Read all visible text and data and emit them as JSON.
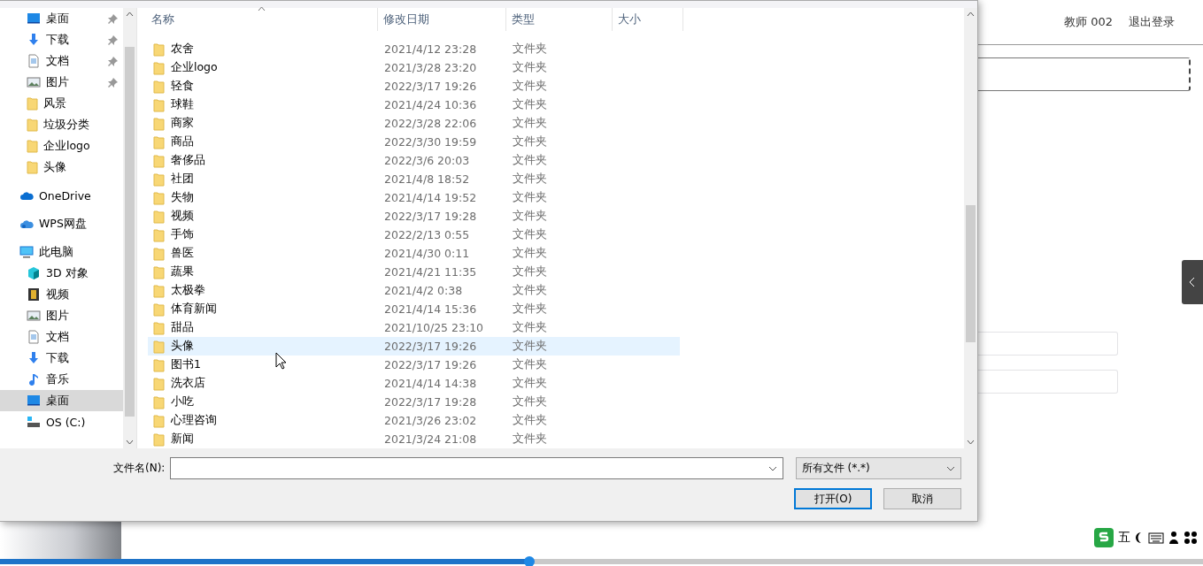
{
  "page": {
    "user": "教师 002",
    "logout": "退出登录",
    "progress": {
      "level": 0.44
    },
    "ime": {
      "mode": "五"
    }
  },
  "dialog": {
    "quick_access": [
      {
        "label": "桌面",
        "kind": "desktop",
        "pinned": true
      },
      {
        "label": "下载",
        "kind": "download",
        "pinned": true
      },
      {
        "label": "文档",
        "kind": "document",
        "pinned": true
      },
      {
        "label": "图片",
        "kind": "picture",
        "pinned": true
      },
      {
        "label": "风景",
        "kind": "folder",
        "pinned": false
      },
      {
        "label": "垃圾分类",
        "kind": "folder",
        "pinned": false
      },
      {
        "label": "企业logo",
        "kind": "folder",
        "pinned": false
      },
      {
        "label": "头像",
        "kind": "folder",
        "pinned": false
      }
    ],
    "locations": [
      {
        "label": "OneDrive",
        "kind": "cloud",
        "selected": false
      },
      {
        "label": "WPS网盘",
        "kind": "wps",
        "selected": false
      },
      {
        "label": "此电脑",
        "kind": "computer",
        "selected": false,
        "children": [
          {
            "label": "3D 对象",
            "kind": "cube",
            "selected": false
          },
          {
            "label": "视频",
            "kind": "video",
            "selected": false
          },
          {
            "label": "图片",
            "kind": "picture",
            "selected": false
          },
          {
            "label": "文档",
            "kind": "document",
            "selected": false
          },
          {
            "label": "下载",
            "kind": "download",
            "selected": false
          },
          {
            "label": "音乐",
            "kind": "music",
            "selected": false
          },
          {
            "label": "桌面",
            "kind": "desktop",
            "selected": true
          },
          {
            "label": "OS (C:)",
            "kind": "drive",
            "selected": false
          }
        ]
      }
    ],
    "columns": [
      "名称",
      "修改日期",
      "类型",
      "大小"
    ],
    "files": [
      {
        "name": "农舍",
        "date": "2021/4/12 23:28",
        "type": "文件夹",
        "selected": false
      },
      {
        "name": "企业logo",
        "date": "2021/3/28 23:20",
        "type": "文件夹",
        "selected": false
      },
      {
        "name": "轻食",
        "date": "2022/3/17 19:26",
        "type": "文件夹",
        "selected": false
      },
      {
        "name": "球鞋",
        "date": "2021/4/24 10:36",
        "type": "文件夹",
        "selected": false
      },
      {
        "name": "商家",
        "date": "2022/3/28 22:06",
        "type": "文件夹",
        "selected": false
      },
      {
        "name": "商品",
        "date": "2022/3/30 19:59",
        "type": "文件夹",
        "selected": false
      },
      {
        "name": "奢侈品",
        "date": "2022/3/6 20:03",
        "type": "文件夹",
        "selected": false
      },
      {
        "name": "社团",
        "date": "2021/4/8 18:52",
        "type": "文件夹",
        "selected": false
      },
      {
        "name": "失物",
        "date": "2021/4/14 19:52",
        "type": "文件夹",
        "selected": false
      },
      {
        "name": "视频",
        "date": "2022/3/17 19:28",
        "type": "文件夹",
        "selected": false
      },
      {
        "name": "手饰",
        "date": "2022/2/13 0:55",
        "type": "文件夹",
        "selected": false
      },
      {
        "name": "兽医",
        "date": "2021/4/30 0:11",
        "type": "文件夹",
        "selected": false
      },
      {
        "name": "蔬果",
        "date": "2021/4/21 11:35",
        "type": "文件夹",
        "selected": false
      },
      {
        "name": "太极拳",
        "date": "2021/4/2 0:38",
        "type": "文件夹",
        "selected": false
      },
      {
        "name": "体育新闻",
        "date": "2021/4/14 15:36",
        "type": "文件夹",
        "selected": false
      },
      {
        "name": "甜品",
        "date": "2021/10/25 23:10",
        "type": "文件夹",
        "selected": false
      },
      {
        "name": "头像",
        "date": "2022/3/17 19:26",
        "type": "文件夹",
        "selected": true
      },
      {
        "name": "图书1",
        "date": "2022/3/17 19:26",
        "type": "文件夹",
        "selected": false
      },
      {
        "name": "洗衣店",
        "date": "2021/4/14 14:38",
        "type": "文件夹",
        "selected": false
      },
      {
        "name": "小吃",
        "date": "2022/3/17 19:28",
        "type": "文件夹",
        "selected": false
      },
      {
        "name": "心理咨询",
        "date": "2021/3/26 23:02",
        "type": "文件夹",
        "selected": false
      },
      {
        "name": "新闻",
        "date": "2021/3/24 21:08",
        "type": "文件夹",
        "selected": false
      }
    ],
    "filename_label": "文件名(N):",
    "filter": "所有文件 (*.*)",
    "buttons": [
      {
        "label": "打开(O)",
        "kind": "primary"
      },
      {
        "label": "取消",
        "kind": "normal"
      }
    ]
  }
}
